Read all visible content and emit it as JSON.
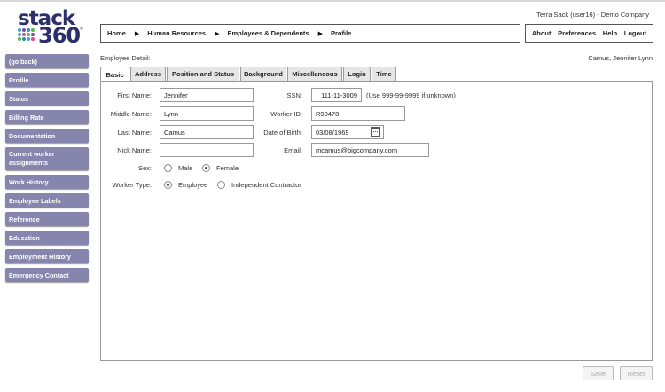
{
  "logo": {
    "word1": "stack",
    "word2": "360",
    "mark": "®"
  },
  "header": {
    "user_info": "Terra Sack (user16) - Demo Company"
  },
  "breadcrumb": [
    "Home",
    "Human Resources",
    "Employees & Dependents",
    "Profile"
  ],
  "top_links": [
    "About",
    "Preferences",
    "Help",
    "Logout"
  ],
  "sidebar": {
    "items": [
      {
        "label": "(go back)"
      },
      {
        "label": "Profile"
      },
      {
        "label": "Status"
      },
      {
        "label": "Billing Rate"
      },
      {
        "label": "Documentation"
      },
      {
        "label": "Current worker assignments"
      },
      {
        "label": "Work History"
      },
      {
        "label": "Employee Labels"
      },
      {
        "label": "Reference"
      },
      {
        "label": "Education"
      },
      {
        "label": "Employment History"
      },
      {
        "label": "Emergency Contact"
      }
    ]
  },
  "detail": {
    "label": "Employee Detail:",
    "employee_name": "Camus, Jennifer Lynn"
  },
  "tabs": [
    {
      "label": "Basic",
      "active": true
    },
    {
      "label": "Address"
    },
    {
      "label": "Position and Status"
    },
    {
      "label": "Background"
    },
    {
      "label": "Miscellaneous"
    },
    {
      "label": "Login"
    },
    {
      "label": "Time"
    }
  ],
  "form": {
    "first_name": {
      "label": "First Name:",
      "value": "Jennifer"
    },
    "middle_name": {
      "label": "Middle Name:",
      "value": "Lynn"
    },
    "last_name": {
      "label": "Last Name:",
      "value": "Camus"
    },
    "nick_name": {
      "label": "Nick Name:",
      "value": ""
    },
    "ssn": {
      "label": "SSN:",
      "value": "111-11-3009",
      "hint": "(Use 999-99-9999 if unknown)"
    },
    "worker_id": {
      "label": "Worker ID:",
      "value": "R90478"
    },
    "dob": {
      "label": "Date of Birth:",
      "value": "03/08/1969"
    },
    "email": {
      "label": "Email:",
      "value": "mcamus@bigcompany.com"
    },
    "sex": {
      "label": "Sex:",
      "options": [
        "Male",
        "Female"
      ],
      "selected": "Female"
    },
    "worker_type": {
      "label": "Worker Type:",
      "options": [
        "Employee",
        "Independent Contractor"
      ],
      "selected": "Employee"
    }
  },
  "actions": {
    "save": "Save",
    "reset": "Reset"
  }
}
